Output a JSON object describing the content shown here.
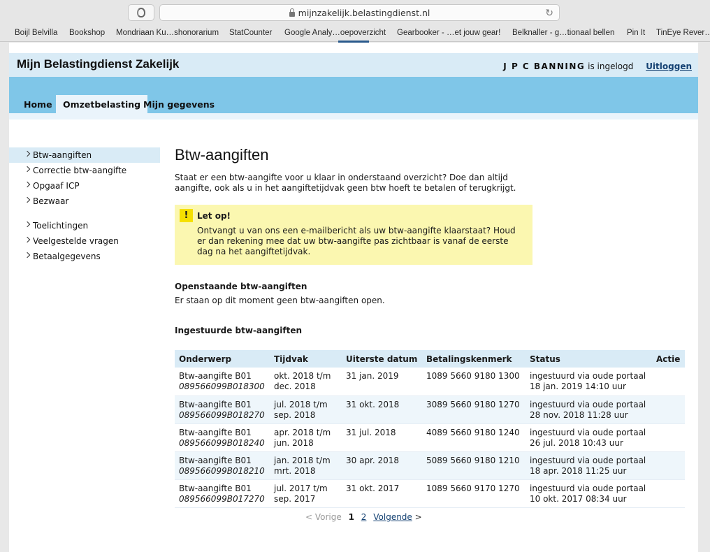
{
  "browser": {
    "url": "mijnzakelijk.belastingdienst.nl",
    "bookmarks": [
      "Boijl Belvilla",
      "Bookshop",
      "Mondriaan Ku…shonorarium",
      "StatCounter",
      "Google Analy…oepoverzicht",
      "Gearbooker - …et jouw gear!",
      "Belknaller - g…tionaal bellen",
      "Pin It",
      "TinEye Rever…"
    ]
  },
  "header": {
    "title": "Mijn Belastingdienst Zakelijk",
    "user_name": "J P C BANNING",
    "logged_in_text": "is ingelogd",
    "logout_label": "Uitloggen"
  },
  "nav": {
    "tabs": [
      {
        "label": "Home"
      },
      {
        "label": "Omzetbelasting"
      },
      {
        "label": "Mijn gegevens"
      }
    ]
  },
  "sidebar": {
    "items": [
      {
        "label": "Btw-aangiften"
      },
      {
        "label": "Correctie btw-aangifte"
      },
      {
        "label": "Opgaaf ICP"
      },
      {
        "label": "Bezwaar"
      },
      {
        "label": "Toelichtingen"
      },
      {
        "label": "Veelgestelde vragen"
      },
      {
        "label": "Betaalgegevens"
      }
    ]
  },
  "main": {
    "title": "Btw-aangiften",
    "intro": "Staat er een btw-aangifte voor u klaar in onderstaand overzicht? Doe dan altijd aangifte, ook als u in het aangiftetijdvak geen btw hoeft te betalen of terugkrijgt.",
    "notice": {
      "icon": "!",
      "title": "Let op!",
      "text": "Ontvangt u van ons een e-mailbericht als uw btw-aangifte klaarstaat? Houd er dan rekening mee dat uw btw-aangifte pas zichtbaar is vanaf de eerste dag na het aangiftetijdvak."
    },
    "open_heading": "Openstaande btw-aangiften",
    "open_text": "Er staan op dit moment geen btw-aangiften open.",
    "submitted_heading": "Ingestuurde btw-aangiften",
    "table": {
      "headers": [
        "Onderwerp",
        "Tijdvak",
        "Uiterste datum",
        "Betalingskenmerk",
        "Status",
        "Actie"
      ],
      "rows": [
        {
          "subject": "Btw-aangifte B01",
          "ref": "089566099B018300",
          "period1": "okt. 2018 t/m",
          "period2": "dec. 2018",
          "deadline": "31 jan. 2019",
          "payment_ref": "1089 5660 9180 1300",
          "status1": "ingestuurd via oude portaal",
          "status2": "18 jan. 2019 14:10 uur"
        },
        {
          "subject": "Btw-aangifte B01",
          "ref": "089566099B018270",
          "period1": "jul. 2018 t/m",
          "period2": "sep. 2018",
          "deadline": "31 okt. 2018",
          "payment_ref": "3089 5660 9180 1270",
          "status1": "ingestuurd via oude portaal",
          "status2": "28 nov. 2018 11:28 uur"
        },
        {
          "subject": "Btw-aangifte B01",
          "ref": "089566099B018240",
          "period1": "apr. 2018 t/m",
          "period2": "jun. 2018",
          "deadline": "31 jul. 2018",
          "payment_ref": "4089 5660 9180 1240",
          "status1": "ingestuurd via oude portaal",
          "status2": "26 jul. 2018 10:43 uur"
        },
        {
          "subject": "Btw-aangifte B01",
          "ref": "089566099B018210",
          "period1": "jan. 2018 t/m",
          "period2": "mrt. 2018",
          "deadline": "30 apr. 2018",
          "payment_ref": "5089 5660 9180 1210",
          "status1": "ingestuurd via oude portaal",
          "status2": "18 apr. 2018 11:25 uur"
        },
        {
          "subject": "Btw-aangifte B01",
          "ref": "089566099B017270",
          "period1": "jul. 2017 t/m",
          "period2": "sep. 2017",
          "deadline": "31 okt. 2017",
          "payment_ref": "1089 5660 9170 1270",
          "status1": "ingestuurd via oude portaal",
          "status2": "10 okt. 2017 08:34 uur"
        }
      ]
    },
    "pagination": {
      "prev": "< Vorige",
      "current": "1",
      "page2": "2",
      "next": "Volgende",
      "next_arrow": ">"
    }
  }
}
